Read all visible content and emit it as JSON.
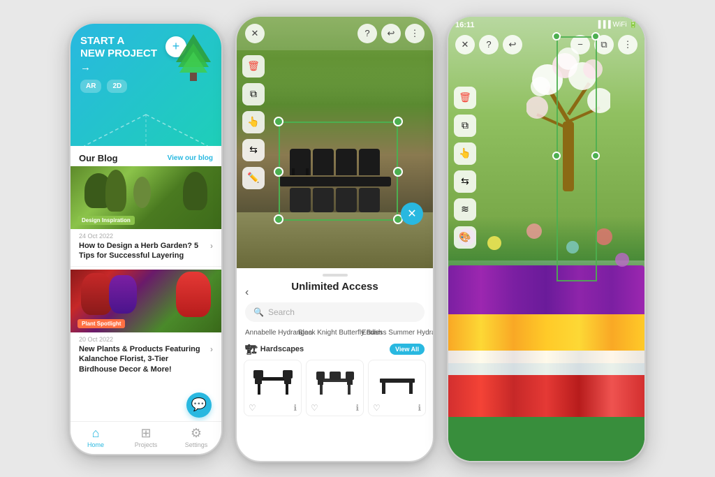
{
  "phone1": {
    "header": {
      "title": "START A\nNEW PROJECT",
      "arrow": "→",
      "ar_btn": "AR",
      "twod_btn": "2D"
    },
    "blog": {
      "section_title": "Our Blog",
      "view_link": "View our blog",
      "post1": {
        "tag": "Design Inspiration",
        "date": "24 Oct 2022",
        "title": "How to Design a Herb Garden? 5 Tips for Successful Layering"
      },
      "post2": {
        "tag": "Plant Spotlight",
        "date": "20 Oct 2022",
        "title": "New Plants & Products Featuring Kalanchoe Florist, 3-Tier Birdhouse Decor & More!"
      }
    },
    "nav": {
      "home": "Home",
      "projects": "Projects",
      "settings": "Settings"
    }
  },
  "phone2": {
    "top_bar": {
      "close": "✕",
      "help": "?",
      "undo": "↩",
      "trash": "🗑",
      "more": "⋮"
    },
    "panel": {
      "title": "Unlimited Access",
      "search_placeholder": "Search",
      "back": "‹",
      "plants": [
        "Annabelle Hydrangea",
        "Black Knight Butterfly Bush",
        "Endless Summer Hydrangea"
      ],
      "hardscapes_label": "Hardscapes",
      "view_all": "View All"
    }
  },
  "phone3": {
    "time": "16:11",
    "status": "▐▐▐ WiFi 🔋",
    "top_bar": {
      "close": "✕",
      "help": "?",
      "undo": "↩",
      "minus": "−",
      "copy": "⧉",
      "more": "⋮"
    }
  },
  "colors": {
    "teal": "#29b8e0",
    "green": "#4caf50",
    "red": "#f44336",
    "lightgray": "#f5f5f5",
    "dark": "#222222"
  }
}
